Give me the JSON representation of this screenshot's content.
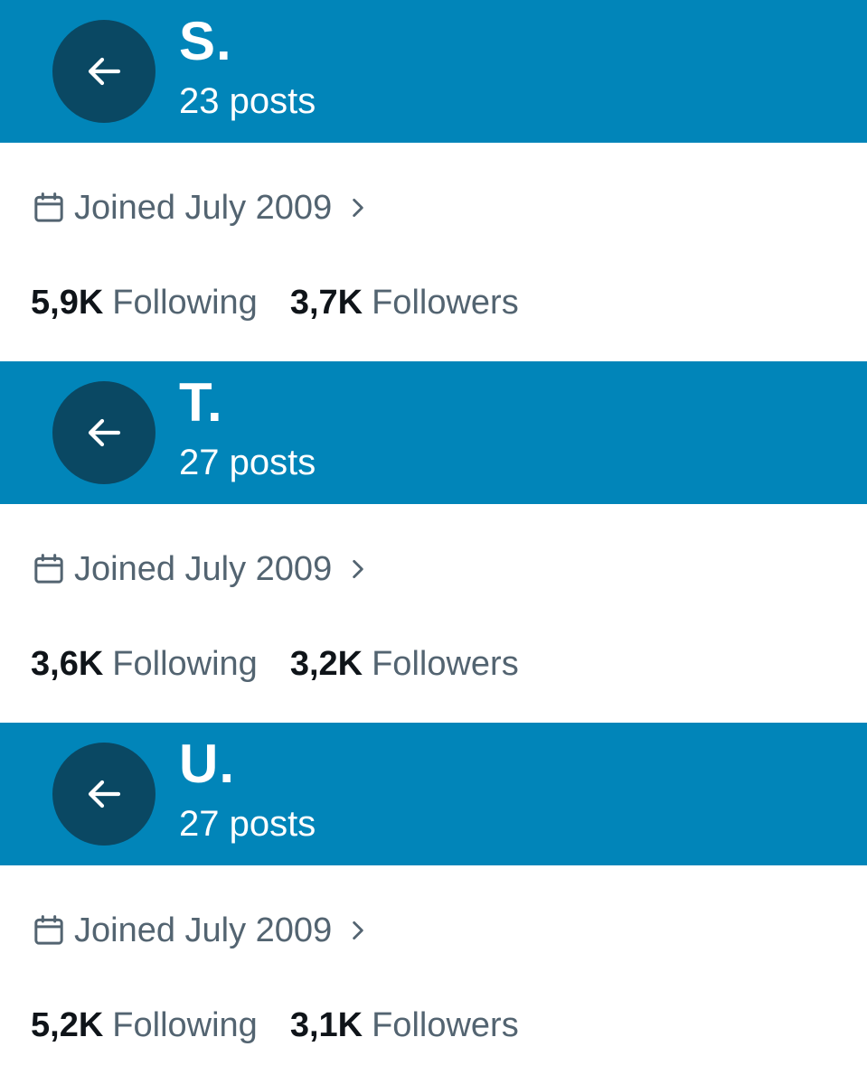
{
  "colors": {
    "accent": "#0185b9",
    "circle": "#0a4863"
  },
  "icons": {
    "back": "left-arrow-icon",
    "calendar": "calendar-icon",
    "chevron": "chevron-right-icon"
  },
  "profiles": [
    {
      "name": "S.",
      "posts": "23 posts",
      "joined": "Joined July 2009",
      "following_count": "5,9K",
      "following_label": "Following",
      "followers_count": "3,7K",
      "followers_label": "Followers"
    },
    {
      "name": "T.",
      "posts": "27 posts",
      "joined": "Joined July 2009",
      "following_count": "3,6K",
      "following_label": "Following",
      "followers_count": "3,2K",
      "followers_label": "Followers"
    },
    {
      "name": "U.",
      "posts": "27 posts",
      "joined": "Joined July 2009",
      "following_count": "5,2K",
      "following_label": "Following",
      "followers_count": "3,1K",
      "followers_label": "Followers"
    }
  ]
}
